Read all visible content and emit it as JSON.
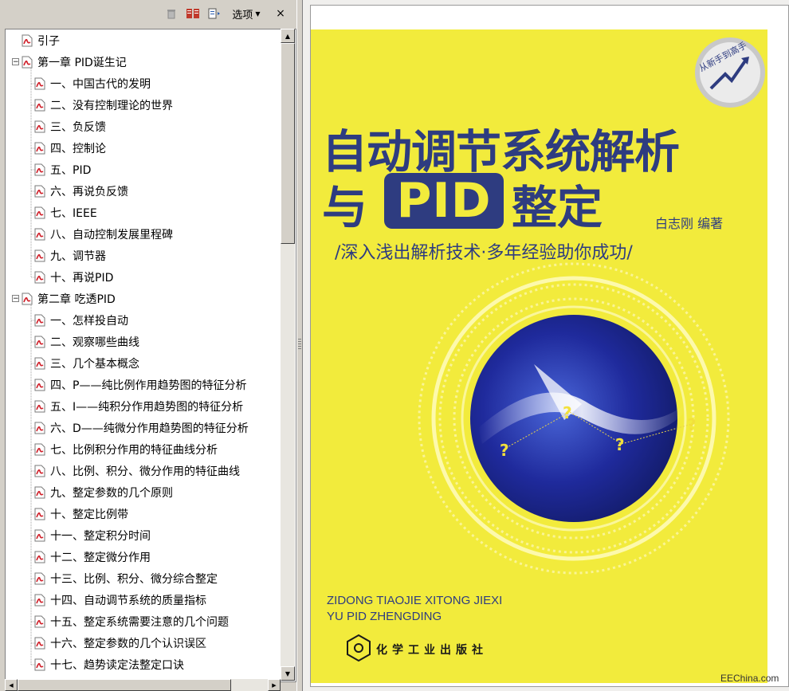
{
  "toolbar": {
    "options_label": "选项",
    "close_glyph": "×"
  },
  "bookmarks": [
    {
      "label": "引子",
      "level": 0,
      "expandable": false
    },
    {
      "label": "第一章  PID诞生记",
      "level": 0,
      "expandable": true
    },
    {
      "label": "一、中国古代的发明",
      "level": 1,
      "expandable": false
    },
    {
      "label": "二、没有控制理论的世界",
      "level": 1,
      "expandable": false
    },
    {
      "label": "三、负反馈",
      "level": 1,
      "expandable": false
    },
    {
      "label": "四、控制论",
      "level": 1,
      "expandable": false
    },
    {
      "label": "五、PID",
      "level": 1,
      "expandable": false
    },
    {
      "label": "六、再说负反馈",
      "level": 1,
      "expandable": false
    },
    {
      "label": "七、IEEE",
      "level": 1,
      "expandable": false
    },
    {
      "label": "八、自动控制发展里程碑",
      "level": 1,
      "expandable": false
    },
    {
      "label": "九、调节器",
      "level": 1,
      "expandable": false
    },
    {
      "label": "十、再说PID",
      "level": 1,
      "expandable": false
    },
    {
      "label": "第二章  吃透PID",
      "level": 0,
      "expandable": true
    },
    {
      "label": "一、怎样投自动",
      "level": 1,
      "expandable": false
    },
    {
      "label": "二、观察哪些曲线",
      "level": 1,
      "expandable": false
    },
    {
      "label": "三、几个基本概念",
      "level": 1,
      "expandable": false
    },
    {
      "label": "四、P——纯比例作用趋势图的特征分析",
      "level": 1,
      "expandable": false
    },
    {
      "label": "五、I——纯积分作用趋势图的特征分析",
      "level": 1,
      "expandable": false
    },
    {
      "label": "六、D——纯微分作用趋势图的特征分析",
      "level": 1,
      "expandable": false
    },
    {
      "label": "七、比例积分作用的特征曲线分析",
      "level": 1,
      "expandable": false
    },
    {
      "label": "八、比例、积分、微分作用的特征曲线",
      "level": 1,
      "expandable": false
    },
    {
      "label": "九、整定参数的几个原则",
      "level": 1,
      "expandable": false
    },
    {
      "label": "十、整定比例带",
      "level": 1,
      "expandable": false
    },
    {
      "label": "十一、整定积分时间",
      "level": 1,
      "expandable": false
    },
    {
      "label": "十二、整定微分作用",
      "level": 1,
      "expandable": false
    },
    {
      "label": "十三、比例、积分、微分综合整定",
      "level": 1,
      "expandable": false
    },
    {
      "label": "十四、自动调节系统的质量指标",
      "level": 1,
      "expandable": false
    },
    {
      "label": "十五、整定系统需要注意的几个问题",
      "level": 1,
      "expandable": false
    },
    {
      "label": "十六、整定参数的几个认识误区",
      "level": 1,
      "expandable": false
    },
    {
      "label": "十七、趋势读定法整定口诀",
      "level": 1,
      "expandable": false
    }
  ],
  "cover": {
    "title_line1": "自动调节系统解析",
    "title_line2_pre": "与",
    "title_line2_pid": "PID",
    "title_line2_post": "整定",
    "author": "白志刚  编著",
    "subtitle": "/深入浅出解析技术·多年经验助你成功/",
    "pinyin_line1": "ZIDONG TIAOJIE XITONG JIEXI",
    "pinyin_line2": "YU PID ZHENGDING",
    "publisher": "化学工业出版社",
    "badge_text": "从新手到高手",
    "question_mark": "?",
    "colors": {
      "background": "#f2eb3c",
      "title": "#2e3c80",
      "globe": "#1f2a8c"
    }
  },
  "watermark": "EEChina.com"
}
